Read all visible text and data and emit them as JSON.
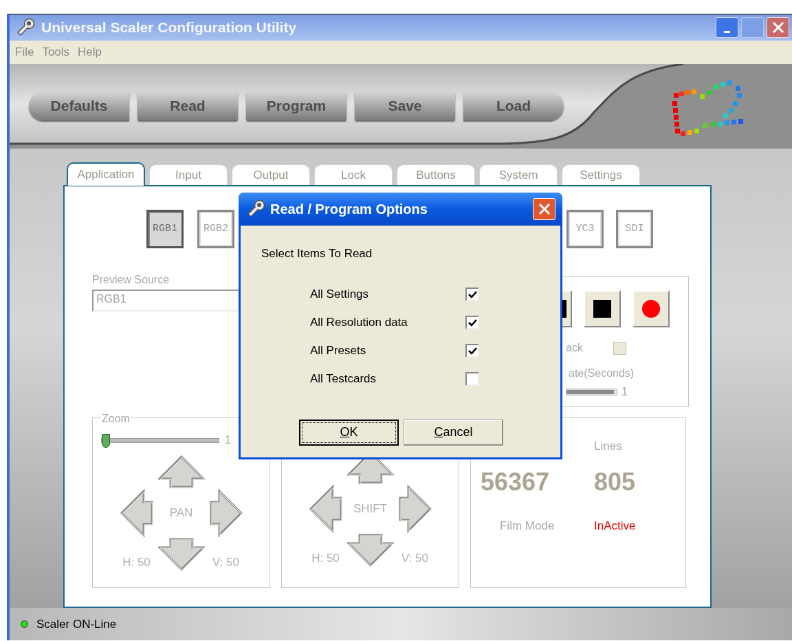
{
  "window": {
    "title": "Universal Scaler Configuration Utility"
  },
  "menu": [
    "File",
    "Tools",
    "Help"
  ],
  "toolbar": [
    "Defaults",
    "Read",
    "Program",
    "Save",
    "Load"
  ],
  "tabs": [
    {
      "label": "Application",
      "selected": true
    },
    {
      "label": "Input",
      "selected": false
    },
    {
      "label": "Output",
      "selected": false
    },
    {
      "label": "Lock",
      "selected": false
    },
    {
      "label": "Buttons",
      "selected": false
    },
    {
      "label": "System",
      "selected": false
    },
    {
      "label": "Settings",
      "selected": false
    }
  ],
  "sources_left": [
    {
      "label": "RGB1",
      "selected": true
    },
    {
      "label": "RGB2",
      "selected": false
    }
  ],
  "sources_right": [
    {
      "label": "YC3",
      "selected": false
    },
    {
      "label": "SDI",
      "selected": false
    }
  ],
  "preview_source": {
    "label": "Preview Source",
    "value": "RGB1"
  },
  "capture": {
    "option_label": "ack",
    "option_checked": false,
    "option_disabled": true,
    "rate_label": "ate(Seconds)",
    "level": 1,
    "reading": "1"
  },
  "zoom": {
    "title": "Zoom",
    "level": 0,
    "reading": "1",
    "center": "PAN",
    "h": "H: 50",
    "v": "V: 50"
  },
  "shift": {
    "center": "SHIFT",
    "h": "H: 50",
    "v": "V: 50"
  },
  "info": {
    "heading_2": "Lines",
    "value_1": "56367",
    "value_2": "805",
    "film_mode_label": "Film Mode",
    "film_mode_value": "InActive"
  },
  "status": {
    "text": "Scaler ON-Line",
    "online": true
  },
  "dialog": {
    "title": "Read / Program Options",
    "prompt": "Select Items To Read",
    "items": [
      {
        "label": "All Settings",
        "checked": true
      },
      {
        "label": "All Resolution data",
        "checked": true
      },
      {
        "label": "All Presets",
        "checked": true
      },
      {
        "label": "All Testcards",
        "checked": false
      }
    ],
    "buttons": [
      {
        "label": "OK",
        "focused": true,
        "mnemonic": true
      },
      {
        "label": "Cancel",
        "focused": false,
        "mnemonic": true
      }
    ]
  }
}
